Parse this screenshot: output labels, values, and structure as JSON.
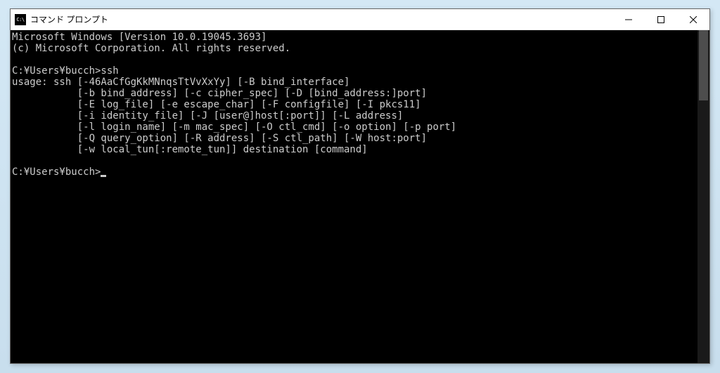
{
  "window": {
    "title": "コマンド プロンプト",
    "icon_label": "C:\\"
  },
  "terminal": {
    "lines": [
      "Microsoft Windows [Version 10.0.19045.3693]",
      "(c) Microsoft Corporation. All rights reserved.",
      "",
      "C:¥Users¥bucch>ssh",
      "usage: ssh [-46AaCfGgKkMNnqsTtVvXxYy] [-B bind_interface]",
      "           [-b bind_address] [-c cipher_spec] [-D [bind_address:]port]",
      "           [-E log_file] [-e escape_char] [-F configfile] [-I pkcs11]",
      "           [-i identity_file] [-J [user@]host[:port]] [-L address]",
      "           [-l login_name] [-m mac_spec] [-O ctl_cmd] [-o option] [-p port]",
      "           [-Q query_option] [-R address] [-S ctl_path] [-W host:port]",
      "           [-w local_tun[:remote_tun]] destination [command]",
      "",
      "C:¥Users¥bucch>"
    ]
  }
}
